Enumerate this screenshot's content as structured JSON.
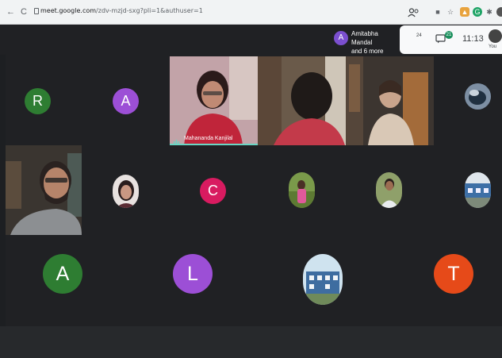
{
  "browser": {
    "back": "←",
    "reload": "C",
    "url_host": "meet.google.com",
    "url_path": "/zdv-mzjd-sxg?pli=1&authuser=1"
  },
  "meet": {
    "presenter_initial": "A",
    "presenter_name": "Amitabha Mandal",
    "presenter_more": "and 6 more",
    "people_count": "24",
    "chat_count": "21",
    "time": "11:13",
    "you_label": "You"
  },
  "participants": {
    "row1": [
      {
        "initial": "R",
        "color": "#2e7d32"
      },
      {
        "initial": "A",
        "color": "#9c4fd6"
      }
    ],
    "row2": [
      {
        "initial": "C",
        "color": "#d81b60"
      }
    ],
    "row3": [
      {
        "initial": "A",
        "color": "#2e7d32"
      },
      {
        "initial": "L",
        "color": "#9c4fd6"
      },
      {
        "initial": "T",
        "color": "#e64a19"
      }
    ],
    "active_speaker_name": "Mahananda Kanjilal"
  }
}
